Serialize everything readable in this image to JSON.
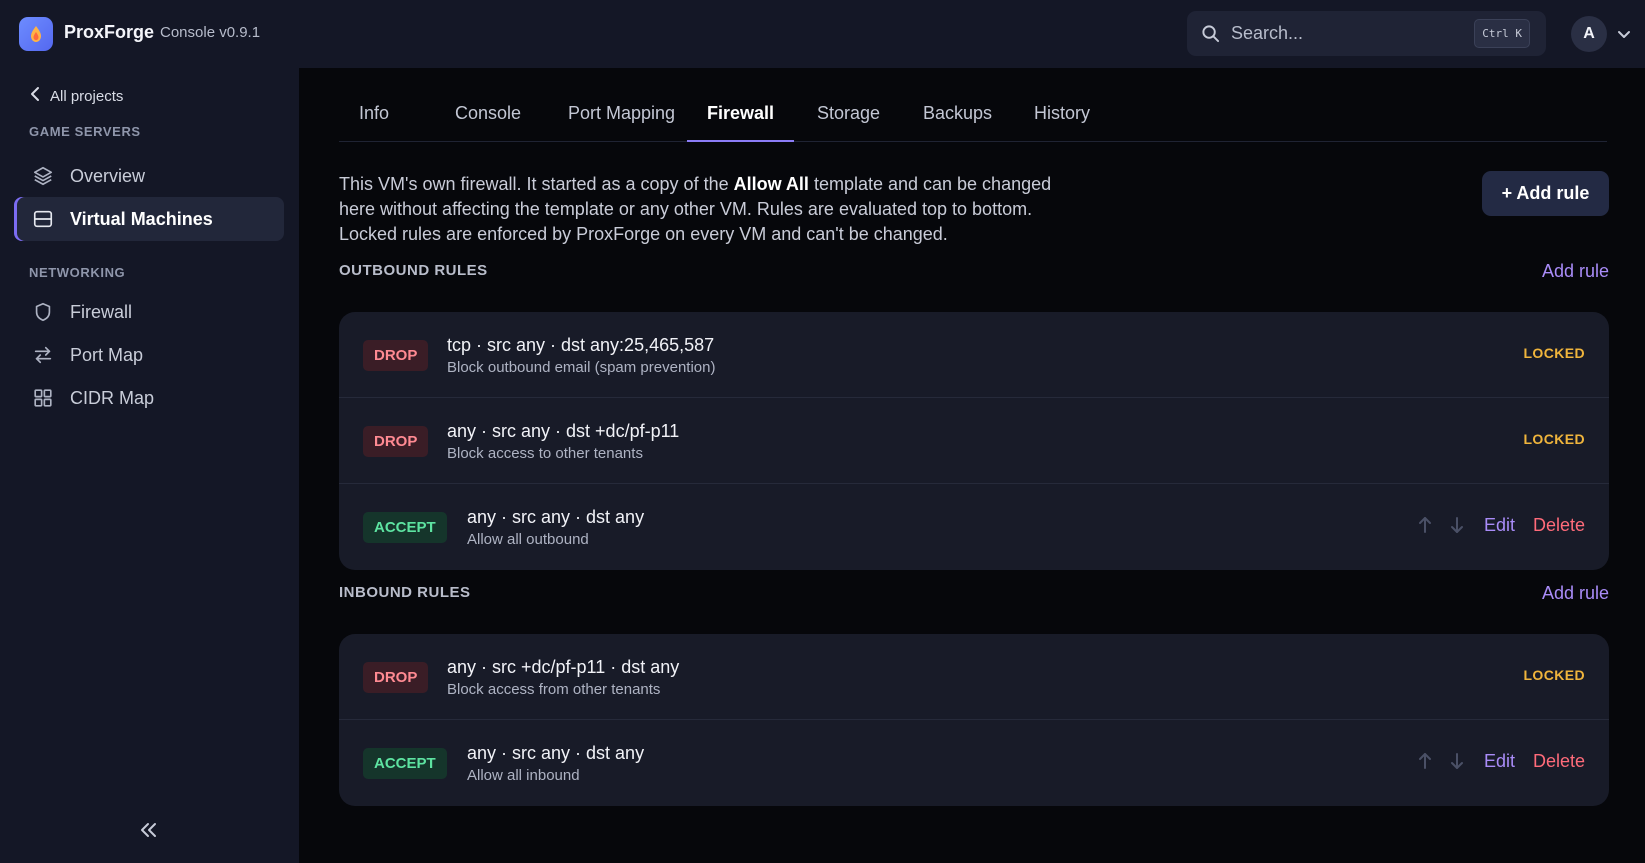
{
  "header": {
    "brand_name": "ProxForge",
    "brand_sub": "Console v0.9.1",
    "search_placeholder": "Search...",
    "search_shortcut": "Ctrl K",
    "avatar_initial": "A"
  },
  "sidebar": {
    "back_label": "All projects",
    "section_game": "GAME SERVERS",
    "section_net": "NETWORKING",
    "items": [
      {
        "label": "Overview",
        "icon": "layers-icon"
      },
      {
        "label": "Virtual Machines",
        "icon": "server-icon",
        "active": true
      },
      {
        "label": "Firewall",
        "icon": "shield-icon"
      },
      {
        "label": "Port Map",
        "icon": "arrows-exchange-icon"
      },
      {
        "label": "CIDR Map",
        "icon": "grid-icon"
      }
    ]
  },
  "tabs": [
    "Info",
    "Console",
    "Port Mapping",
    "Firewall",
    "Storage",
    "Backups",
    "History"
  ],
  "active_tab": "Firewall",
  "description": {
    "part1": "This VM's own firewall. It started as a copy of the ",
    "bold": "Allow All",
    "part2": " template and can be changed here without affecting the template or any other VM. Rules are evaluated top to bottom. Locked rules are enforced by ProxForge on every VM and can't be changed."
  },
  "add_rule_button": "+ Add rule",
  "outbound": {
    "title": "OUTBOUND RULES",
    "add_link": "Add rule",
    "rules": [
      {
        "action": "DROP",
        "rule": "tcp · src any · dst any:25,465,587",
        "desc": "Block outbound email (spam prevention)",
        "locked": "LOCKED"
      },
      {
        "action": "DROP",
        "rule": "any · src any · dst +dc/pf-p11",
        "desc": "Block access to other tenants",
        "locked": "LOCKED"
      },
      {
        "action": "ACCEPT",
        "rule": "any · src any · dst any",
        "desc": "Allow all outbound",
        "edit": "Edit",
        "delete": "Delete"
      }
    ]
  },
  "inbound": {
    "title": "INBOUND RULES",
    "add_link": "Add rule",
    "rules": [
      {
        "action": "DROP",
        "rule": "any · src +dc/pf-p11 · dst any",
        "desc": "Block access from other tenants",
        "locked": "LOCKED"
      },
      {
        "action": "ACCEPT",
        "rule": "any · src any · dst any",
        "desc": "Allow all inbound",
        "edit": "Edit",
        "delete": "Delete"
      }
    ]
  },
  "colors": {
    "accent": "#8b7cf6",
    "drop": "#ff8a92",
    "accept": "#5de3a1",
    "locked": "#f0b53c",
    "delete": "#ff6b7a"
  }
}
